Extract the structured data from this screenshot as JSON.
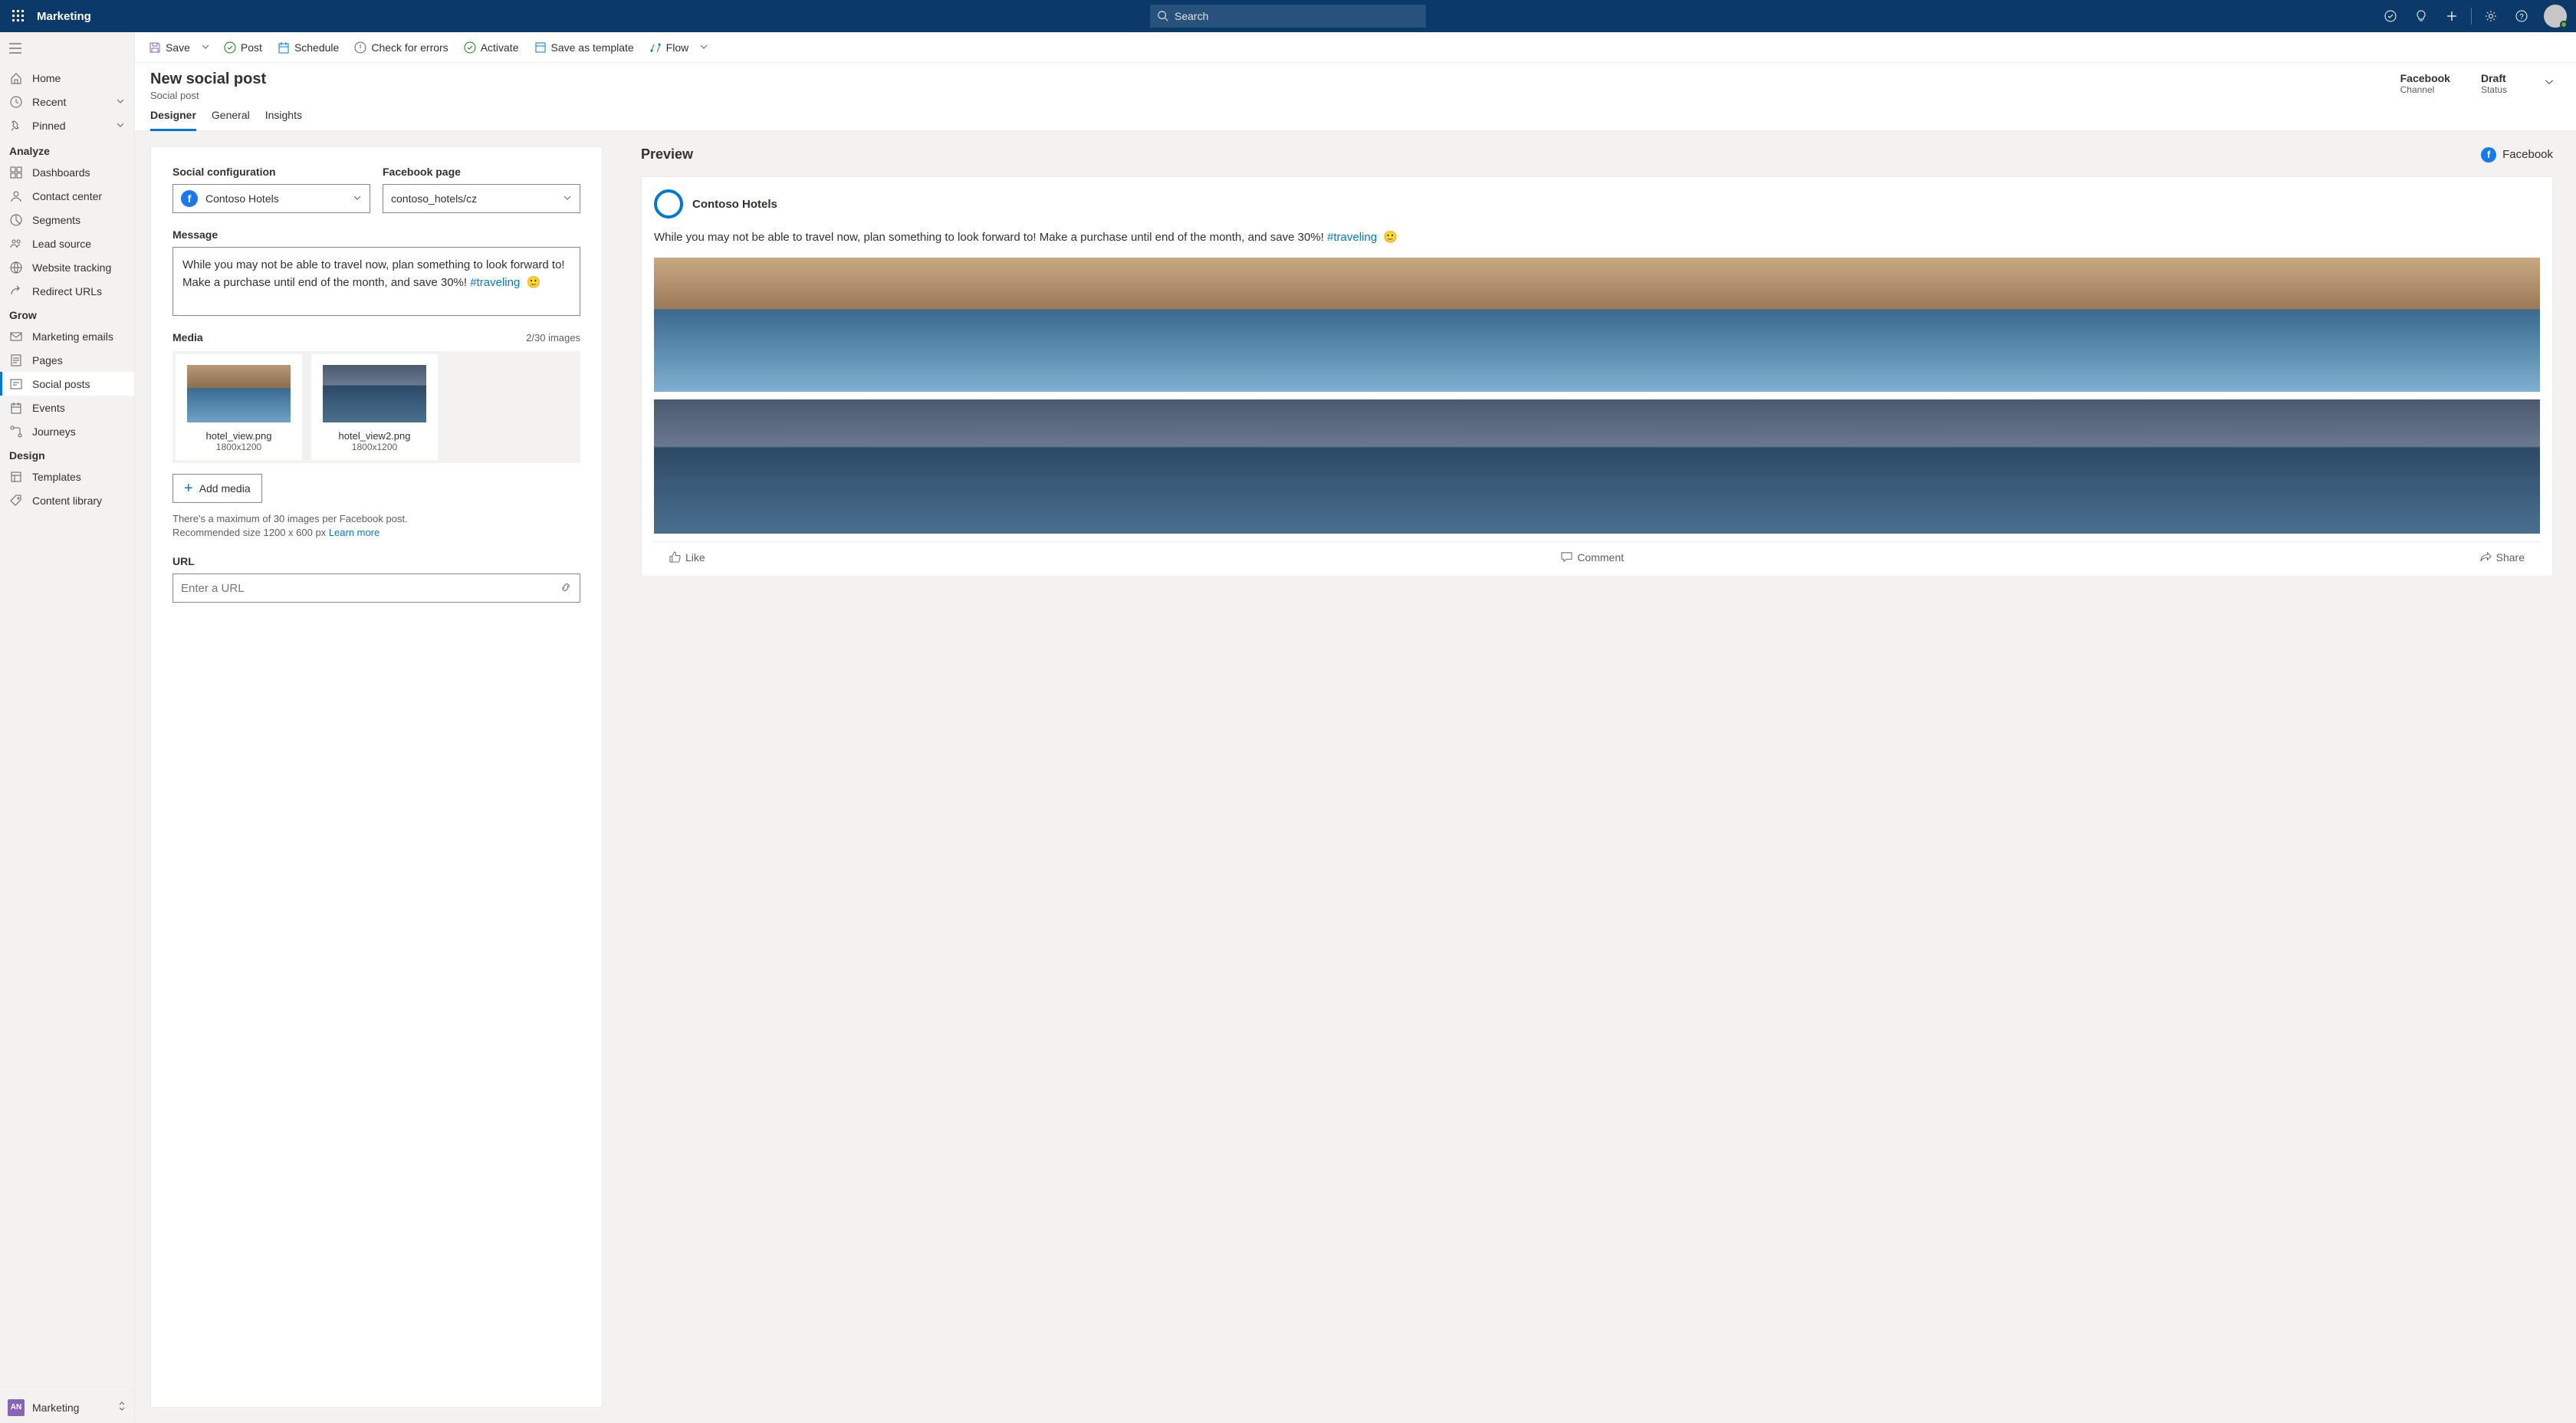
{
  "topbar": {
    "title": "Marketing",
    "search_placeholder": "Search"
  },
  "nav": {
    "home": "Home",
    "recent": "Recent",
    "pinned": "Pinned",
    "sections": {
      "analyze": {
        "label": "Analyze",
        "items": [
          "Dashboards",
          "Contact center",
          "Segments",
          "Lead source",
          "Website tracking",
          "Redirect URLs"
        ]
      },
      "grow": {
        "label": "Grow",
        "items": [
          "Marketing emails",
          "Pages",
          "Social posts",
          "Events",
          "Journeys"
        ]
      },
      "design": {
        "label": "Design",
        "items": [
          "Templates",
          "Content library"
        ]
      }
    },
    "footer": {
      "badge": "AN",
      "label": "Marketing"
    }
  },
  "cmdbar": {
    "save": "Save",
    "post": "Post",
    "schedule": "Schedule",
    "check": "Check for errors",
    "activate": "Activate",
    "save_template": "Save as template",
    "flow": "Flow"
  },
  "header": {
    "title": "New social post",
    "subtitle": "Social post",
    "channel_val": "Facebook",
    "channel_lbl": "Channel",
    "status_val": "Draft",
    "status_lbl": "Status"
  },
  "tabs": [
    "Designer",
    "General",
    "Insights"
  ],
  "form": {
    "social_config_label": "Social configuration",
    "social_config_value": "Contoso Hotels",
    "page_label": "Facebook page",
    "page_value": "contoso_hotels/cz",
    "message_label": "Message",
    "message_text": "While you may not be able to travel now, plan something to look forward to! Make a purchase until end of the month, and save 30%!",
    "message_hashtag": "#traveling",
    "media_label": "Media",
    "media_count": "2/30 images",
    "media_items": [
      {
        "name": "hotel_view.png",
        "dim": "1800x1200"
      },
      {
        "name": "hotel_view2.png",
        "dim": "1800x1200"
      }
    ],
    "add_media": "Add media",
    "help1": "There's a maximum of 30 images per Facebook post.",
    "help2": "Recommended size 1200 x 600 px",
    "learn_more": "Learn more",
    "url_label": "URL",
    "url_placeholder": "Enter a URL"
  },
  "preview": {
    "title": "Preview",
    "channel": "Facebook",
    "profile_name": "Contoso Hotels",
    "text": "While you may not be able to travel now, plan something to look forward to! Make a purchase until end of the month, and save 30%!",
    "hashtag": "#traveling",
    "like": "Like",
    "comment": "Comment",
    "share": "Share"
  }
}
